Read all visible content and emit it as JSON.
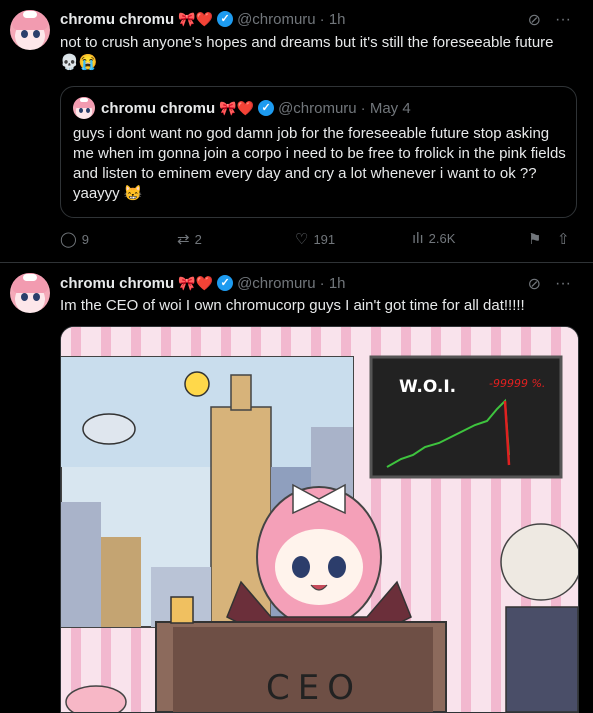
{
  "tweet1": {
    "name": "chromu chromu",
    "handle": "@chromuru",
    "time": "· 1h",
    "text": "not to crush anyone's hopes and dreams but it's still the foreseeable future",
    "text_emoji": "💀😭",
    "name_emoji": "🎀❤️",
    "quote": {
      "name": "chromu chromu",
      "handle": "@chromuru",
      "time": "· May 4",
      "name_emoji": "🎀❤️",
      "text": "guys i dont want no god damn job for the foreseeable future stop asking me when im gonna join a corpo i need to be free to frolick in the pink fields and listen to eminem every day and cry a lot whenever i want to ok ?? yaayyy",
      "text_emoji": "😸"
    },
    "replies": "9",
    "reposts": "2",
    "likes": "191",
    "views": "2.6K"
  },
  "tweet2": {
    "name": "chromu chromu",
    "handle": "@chromuru",
    "time": "· 1h",
    "name_emoji": "🎀❤️",
    "text": "Im the CEO of woi I own chromucorp guys I ain't got time for all dat!!!!!",
    "image": {
      "board_title": "W.O.I.",
      "board_value": "-99999 %.",
      "desk_label": "CEO"
    }
  },
  "icons": {
    "verified": "verified-badge-icon",
    "grok": "grok-icon",
    "more": "more-icon",
    "reply": "reply-icon",
    "repost": "repost-icon",
    "like": "like-icon",
    "views": "views-icon",
    "bookmark": "bookmark-icon",
    "share": "share-icon"
  },
  "colors": {
    "background": "#000000",
    "text": "#e7e9ea",
    "muted": "#71767b",
    "accent": "#1d9bf0",
    "border": "#2f3336"
  }
}
